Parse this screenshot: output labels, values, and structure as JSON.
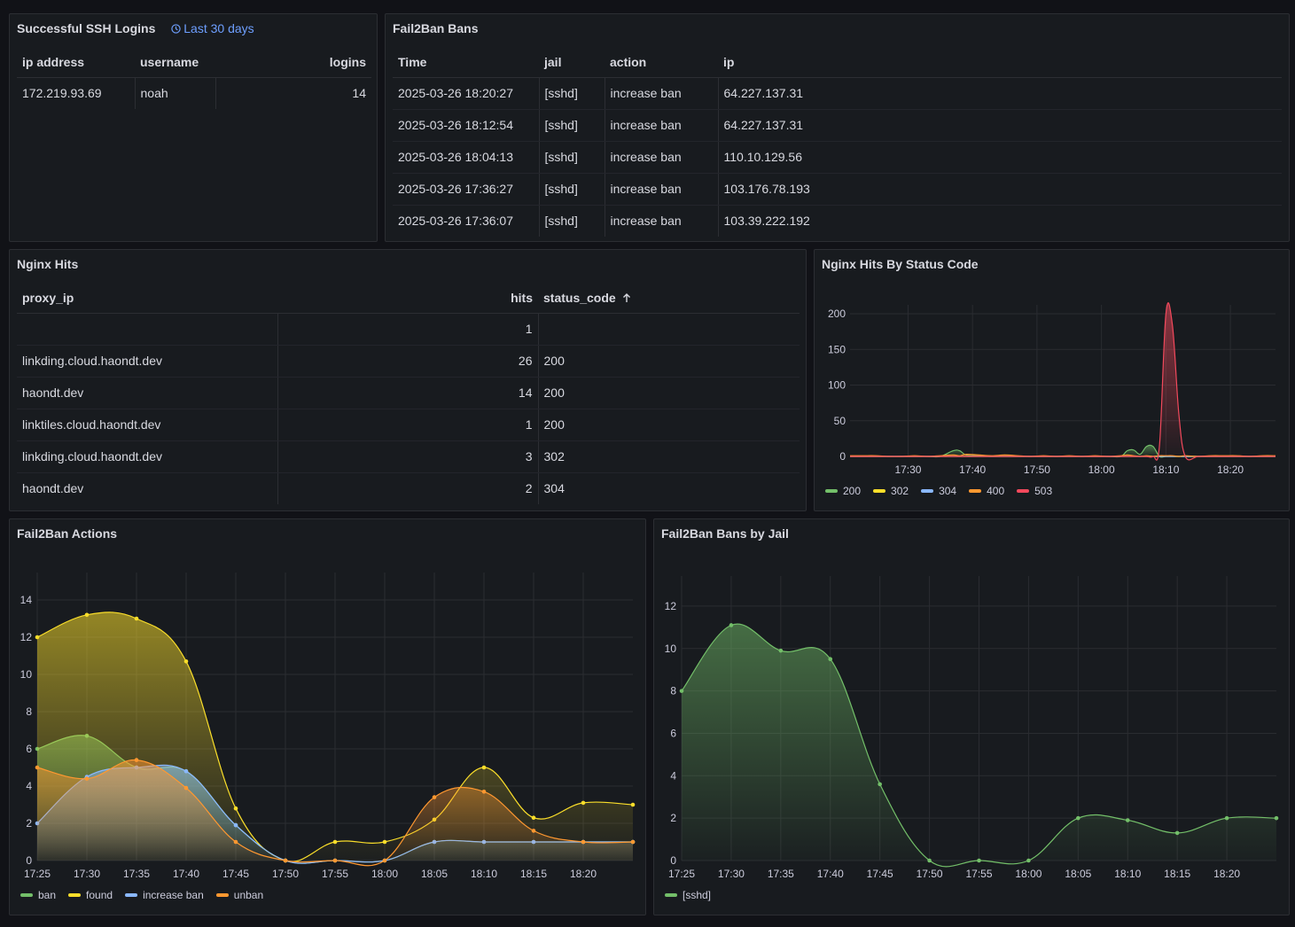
{
  "colors": {
    "green": "#73bf69",
    "yellow": "#fade2a",
    "blue": "#8ab8ff",
    "orange": "#ff9830",
    "red": "#f2495c",
    "accent": "#6e9fff"
  },
  "ssh": {
    "title": "Successful SSH Logins",
    "range_label": "Last 30 days",
    "range_icon": "clock-icon",
    "columns": [
      "ip address",
      "username",
      "logins"
    ],
    "rows": [
      [
        "172.219.93.69",
        "noah",
        "14"
      ]
    ]
  },
  "bans": {
    "title": "Fail2Ban Bans",
    "columns": [
      "Time",
      "jail",
      "action",
      "ip"
    ],
    "rows": [
      [
        "2025-03-26 18:20:27",
        "[sshd]",
        "increase ban",
        "64.227.137.31"
      ],
      [
        "2025-03-26 18:12:54",
        "[sshd]",
        "increase ban",
        "64.227.137.31"
      ],
      [
        "2025-03-26 18:04:13",
        "[sshd]",
        "increase ban",
        "110.10.129.56"
      ],
      [
        "2025-03-26 17:36:27",
        "[sshd]",
        "increase ban",
        "103.176.78.193"
      ],
      [
        "2025-03-26 17:36:07",
        "[sshd]",
        "increase ban",
        "103.39.222.192"
      ]
    ]
  },
  "nginx": {
    "title": "Nginx Hits",
    "columns": [
      "proxy_ip",
      "hits",
      "status_code"
    ],
    "sort_icon": "arrow-up-icon",
    "rows": [
      [
        "",
        "1",
        ""
      ],
      [
        "linkding.cloud.haondt.dev",
        "26",
        "200"
      ],
      [
        "haondt.dev",
        "14",
        "200"
      ],
      [
        "linktiles.cloud.haondt.dev",
        "1",
        "200"
      ],
      [
        "linkding.cloud.haondt.dev",
        "3",
        "302"
      ],
      [
        "haondt.dev",
        "2",
        "304"
      ]
    ]
  },
  "chart_data": [
    {
      "type": "area",
      "title": "Nginx Hits By Status Code",
      "x_ticks": [
        "17:30",
        "17:40",
        "17:50",
        "18:00",
        "18:10",
        "18:20"
      ],
      "x": [
        "17:21",
        "17:23",
        "17:25",
        "17:27",
        "17:29",
        "17:31",
        "17:33",
        "17:35",
        "17:37",
        "17:38",
        "17:39",
        "17:41",
        "17:43",
        "17:45",
        "17:47",
        "17:49",
        "17:51",
        "17:53",
        "17:55",
        "17:57",
        "17:59",
        "18:01",
        "18:03",
        "18:04",
        "18:05",
        "18:06",
        "18:07",
        "18:08",
        "18:09",
        "18:10",
        "18:11",
        "18:12",
        "18:13",
        "18:15",
        "18:17",
        "18:19",
        "18:21",
        "18:23",
        "18:25",
        "18:27"
      ],
      "ylim": [
        0,
        200
      ],
      "y_ticks": [
        0,
        50,
        100,
        150,
        200
      ],
      "series": [
        {
          "name": "200",
          "color": "#73bf69",
          "values": [
            0,
            0,
            0,
            0,
            0,
            0,
            0,
            0,
            8,
            8,
            2,
            1,
            0,
            0,
            0,
            0,
            0,
            0,
            0,
            0,
            0,
            0,
            0,
            8,
            9,
            3,
            14,
            14,
            0,
            0,
            0,
            0,
            0,
            0,
            0,
            0,
            0,
            0,
            0,
            0
          ]
        },
        {
          "name": "302",
          "color": "#fade2a",
          "values": [
            0,
            0,
            0,
            0,
            0,
            0,
            0,
            0,
            0,
            0,
            0,
            0,
            0,
            0,
            0,
            0,
            0,
            0,
            0,
            0,
            0,
            0,
            0,
            0,
            0,
            0,
            0,
            0,
            0,
            0,
            0,
            0,
            0,
            0,
            0,
            0,
            0,
            0,
            0,
            0
          ]
        },
        {
          "name": "304",
          "color": "#8ab8ff",
          "values": [
            0,
            0,
            0,
            0,
            0,
            0,
            0,
            0,
            0,
            0,
            0,
            0,
            0,
            0,
            0,
            0,
            0,
            0,
            0,
            0,
            0,
            0,
            0,
            0,
            0,
            0,
            0,
            0,
            0,
            0,
            0,
            0,
            0,
            0,
            0,
            0,
            0,
            0,
            0,
            0
          ]
        },
        {
          "name": "400",
          "color": "#ff9830",
          "values": [
            1,
            1,
            1,
            0,
            0,
            1,
            0,
            1,
            2,
            1,
            3,
            2,
            1,
            2,
            1,
            0,
            1,
            0,
            1,
            0,
            1,
            0,
            1,
            2,
            1,
            0,
            1,
            0,
            1,
            1,
            1,
            0,
            1,
            0,
            1,
            1,
            1,
            0,
            1,
            1
          ]
        },
        {
          "name": "503",
          "color": "#f2495c",
          "values": [
            0,
            0,
            0,
            0,
            0,
            0,
            0,
            0,
            0,
            0,
            0,
            0,
            0,
            0,
            0,
            0,
            0,
            0,
            0,
            0,
            0,
            0,
            0,
            0,
            0,
            0,
            0,
            0,
            15,
            200,
            185,
            60,
            0,
            0,
            0,
            0,
            0,
            0,
            0,
            0
          ]
        }
      ]
    },
    {
      "type": "line",
      "title": "Fail2Ban Actions",
      "x": [
        "17:25",
        "17:30",
        "17:35",
        "17:40",
        "17:45",
        "17:50",
        "17:55",
        "18:00",
        "18:05",
        "18:10",
        "18:15",
        "18:20",
        "18:25"
      ],
      "x_ticks": [
        "17:25",
        "17:30",
        "17:35",
        "17:40",
        "17:45",
        "17:50",
        "17:55",
        "18:00",
        "18:05",
        "18:10",
        "18:15",
        "18:20"
      ],
      "ylim": [
        0,
        15
      ],
      "y_ticks": [
        0,
        2,
        4,
        6,
        8,
        10,
        12,
        14
      ],
      "series": [
        {
          "name": "ban",
          "color": "#73bf69",
          "values": [
            6,
            6.7,
            5,
            4.8,
            1.9,
            0,
            0,
            0,
            1,
            1,
            1,
            1,
            1
          ]
        },
        {
          "name": "found",
          "color": "#fade2a",
          "values": [
            12,
            13.2,
            13,
            10.7,
            2.8,
            0,
            1,
            1,
            2.2,
            5,
            2.3,
            3.1,
            3
          ]
        },
        {
          "name": "increase ban",
          "color": "#8ab8ff",
          "values": [
            2,
            4.5,
            5,
            4.8,
            1.9,
            0,
            0,
            0,
            1,
            1,
            1,
            1,
            1
          ]
        },
        {
          "name": "unban",
          "color": "#ff9830",
          "values": [
            5,
            4.4,
            5.4,
            3.9,
            1,
            0,
            0,
            0,
            3.4,
            3.7,
            1.6,
            1,
            1
          ]
        }
      ]
    },
    {
      "type": "line",
      "title": "Fail2Ban Bans by Jail",
      "x": [
        "17:25",
        "17:30",
        "17:35",
        "17:40",
        "17:45",
        "17:50",
        "17:55",
        "18:00",
        "18:05",
        "18:10",
        "18:15",
        "18:20",
        "18:25"
      ],
      "x_ticks": [
        "17:25",
        "17:30",
        "17:35",
        "17:40",
        "17:45",
        "17:50",
        "17:55",
        "18:00",
        "18:05",
        "18:10",
        "18:15",
        "18:20"
      ],
      "ylim": [
        0,
        13
      ],
      "y_ticks": [
        0,
        2,
        4,
        6,
        8,
        10,
        12
      ],
      "series": [
        {
          "name": "[sshd]",
          "color": "#73bf69",
          "values": [
            8,
            11.1,
            9.9,
            9.5,
            3.6,
            0,
            0,
            0,
            2,
            1.9,
            1.3,
            2,
            2
          ]
        }
      ]
    }
  ]
}
